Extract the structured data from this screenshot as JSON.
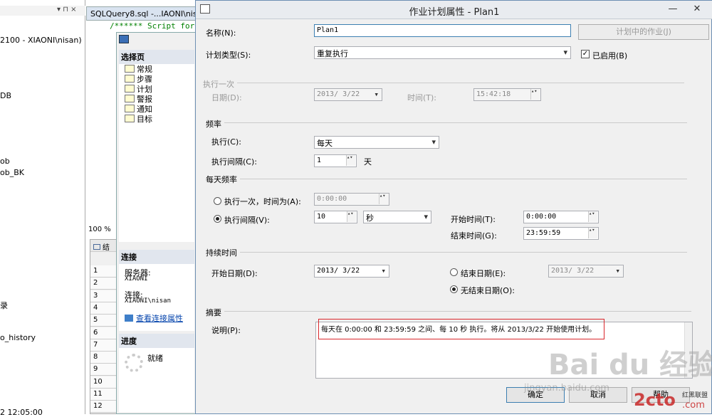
{
  "object_explorer": {
    "header_close": "▾ ⊓ ×",
    "items": [
      "2100 - XIAONI\\nisan)",
      "DB",
      "ob",
      "ob_BK",
      "录",
      "o_history",
      "2 12:05:00"
    ]
  },
  "editor": {
    "tab_title": "SQLQuery8.sql -...IAONI\\nisan",
    "code_line": "/****** Script for S",
    "zoom": "100 %",
    "results_tab": "结",
    "row_numbers": [
      "1",
      "2",
      "3",
      "4",
      "5",
      "6",
      "7",
      "8",
      "9",
      "10",
      "11",
      "12"
    ]
  },
  "job_dialog": {
    "select_page_title": "选择页",
    "pages": [
      "常规",
      "步骤",
      "计划",
      "警报",
      "通知",
      "目标"
    ],
    "connection_title": "连接",
    "server_label": "服务器:",
    "server_value": "XIAONI",
    "connection_label": "连接:",
    "connection_value": "XIAONI\\nisan",
    "view_conn_link": "查看连接属性",
    "progress_title": "进度",
    "progress_status": "就绪"
  },
  "dialog": {
    "title": "作业计划属性 - Plan1",
    "name_label": "名称(N):",
    "name_value": "Plan1",
    "jobs_in_schedule_button": "计划中的作业(J)",
    "schedule_type_label": "计划类型(S):",
    "schedule_type_value": "重复执行",
    "enabled_label": "已启用(B)",
    "enabled": true,
    "once_section": "执行一次",
    "once_date_label": "日期(D):",
    "once_date_value": "2013/ 3/22",
    "once_time_label": "时间(T):",
    "once_time_value": "15:42:18",
    "frequency_section": "频率",
    "occurs_label": "执行(C):",
    "occurs_value": "每天",
    "recurs_label": "执行间隔(C):",
    "recurs_value": "1",
    "recurs_unit": "天",
    "daily_section": "每天频率",
    "occurs_once_label": "执行一次，时间为(A):",
    "occurs_once_value": "0:00:00",
    "occurs_every_label": "执行间隔(V):",
    "occurs_every_value": "10",
    "occurs_every_unit": "秒",
    "start_time_label": "开始时间(T):",
    "start_time_value": "0:00:00",
    "end_time_label": "结束时间(G):",
    "end_time_value": "23:59:59",
    "duration_section": "持续时间",
    "start_date_label": "开始日期(D):",
    "start_date_value": "2013/ 3/22",
    "end_date_label": "结束日期(E):",
    "end_date_value": "2013/ 3/22",
    "no_end_date_label": "无结束日期(O):",
    "summary_section": "摘要",
    "description_label": "说明(P):",
    "description_value": "每天在 0:00:00 和 23:59:59 之间、每 10 秒 执行。将从 2013/3/22 开始使用计划。",
    "ok_button": "确定",
    "cancel_button": "取消",
    "help_button": "帮助"
  },
  "watermarks": {
    "baidu": "Bai du 经验",
    "baidu_url": "jingyan.baidu.com",
    "site": "2cto",
    "site_sub": "红黑联盟",
    "site_url": ".com"
  },
  "colors": {
    "highlight_box": "#d9262b",
    "link": "#0645ad"
  }
}
